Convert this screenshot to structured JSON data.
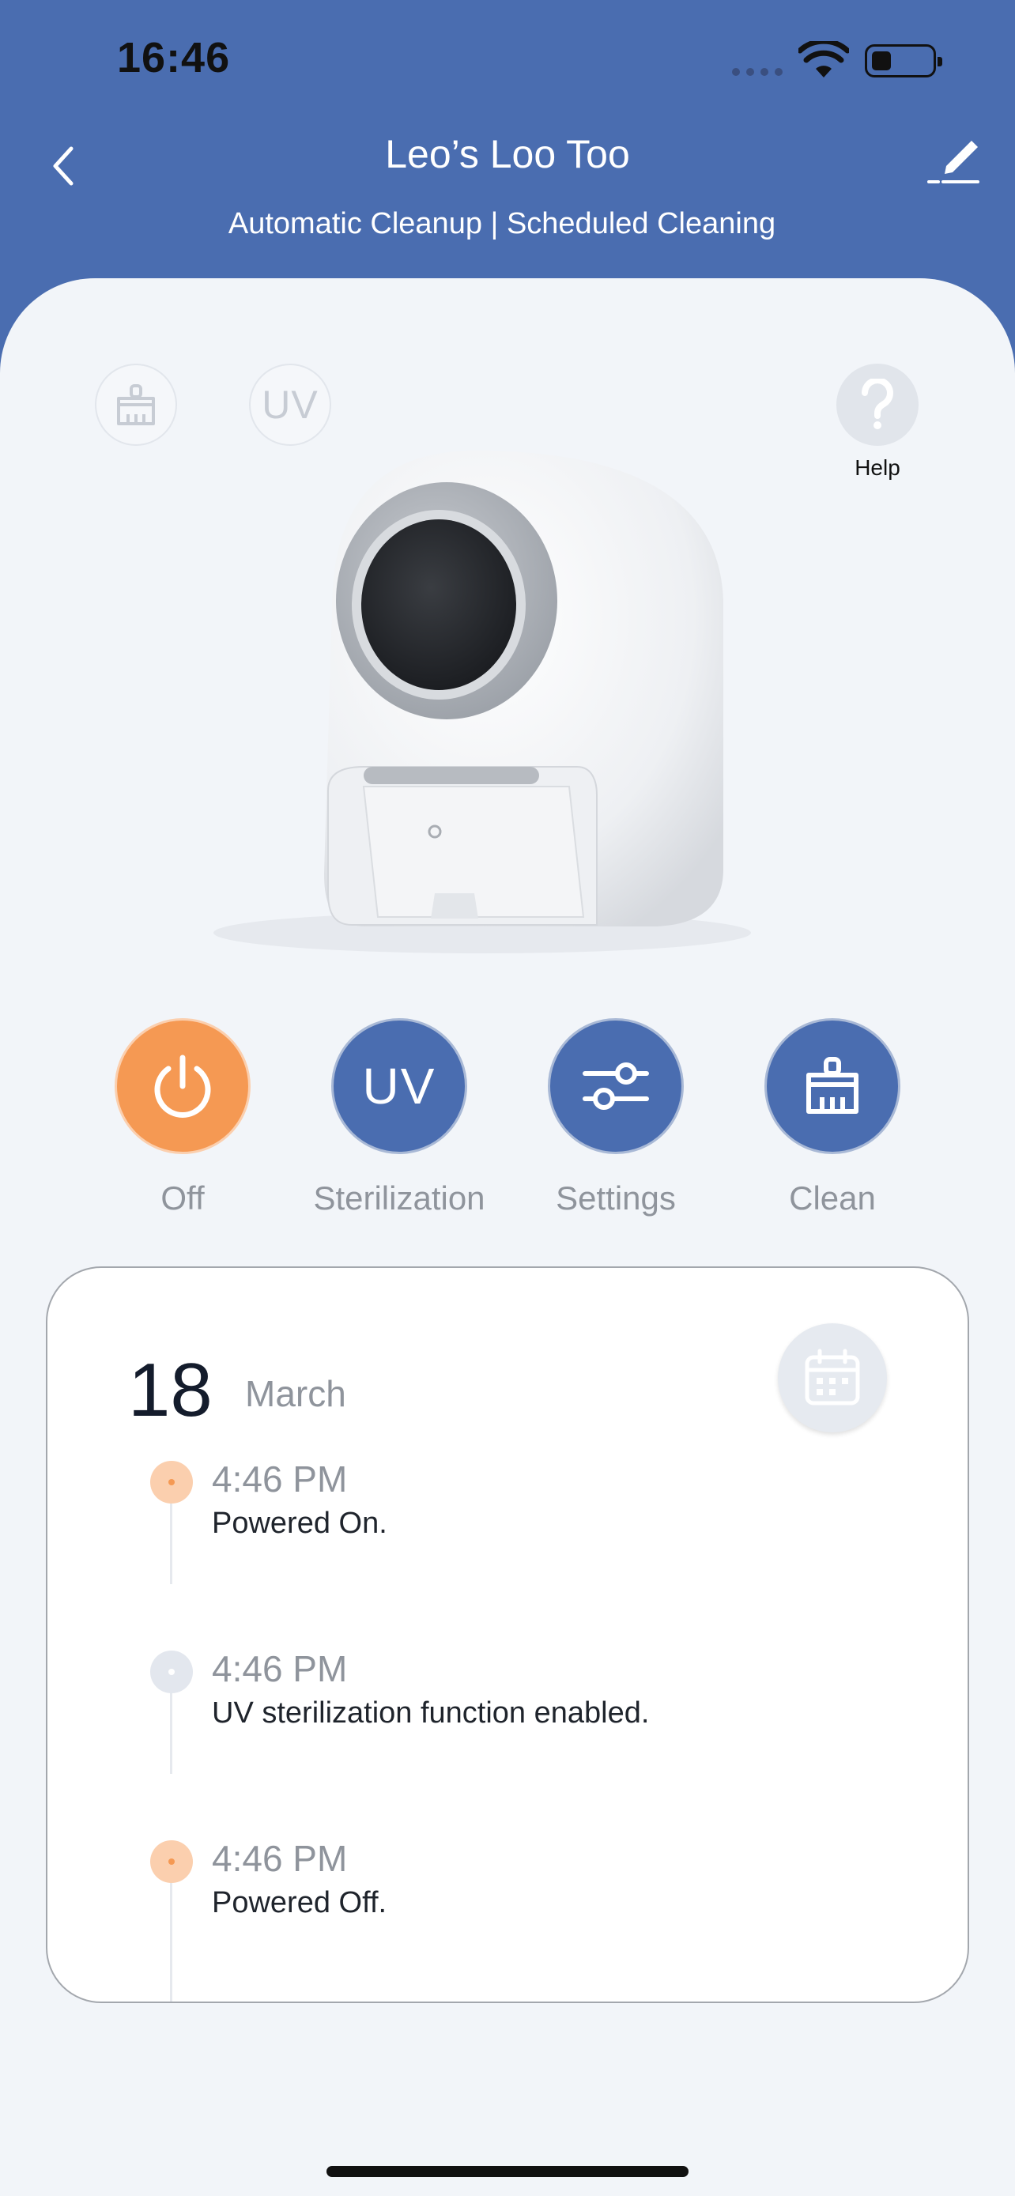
{
  "status_bar": {
    "time": "16:46",
    "icons": [
      "cellular-signal-icon",
      "wifi-icon",
      "battery-icon"
    ],
    "battery_level": 0.25
  },
  "nav": {
    "title": "Leo’s Loo Too",
    "subtitle": "Automatic Cleanup | Scheduled Cleaning",
    "back_icon": "chevron-left-icon",
    "edit_icon": "edit-pencil-icon"
  },
  "status_indicators": {
    "clean_icon": "broom-icon",
    "uv_label": "UV",
    "help_label": "Help",
    "help_icon": "question-mark-icon"
  },
  "actions": [
    {
      "label": "Off",
      "icon": "power-icon",
      "color": "#f59953"
    },
    {
      "label": "Sterilization",
      "icon_text": "UV",
      "color": "#4a6db0"
    },
    {
      "label": "Settings",
      "icon": "sliders-icon",
      "color": "#4a6db0"
    },
    {
      "label": "Clean",
      "icon": "broom-icon",
      "color": "#4a6db0"
    }
  ],
  "log": {
    "day": "18",
    "month": "March",
    "calendar_icon": "calendar-icon",
    "events": [
      {
        "time": "4:46 PM",
        "text": "Powered On.",
        "dot": "orange"
      },
      {
        "time": "4:46 PM",
        "text": "UV sterilization function enabled.",
        "dot": "grey"
      },
      {
        "time": "4:46 PM",
        "text": "Powered Off.",
        "dot": "orange"
      }
    ]
  },
  "colors": {
    "header_bg": "#4a6db0",
    "sheet_bg": "#f2f5f9",
    "accent_orange": "#f59953",
    "accent_blue": "#4a6db0"
  }
}
